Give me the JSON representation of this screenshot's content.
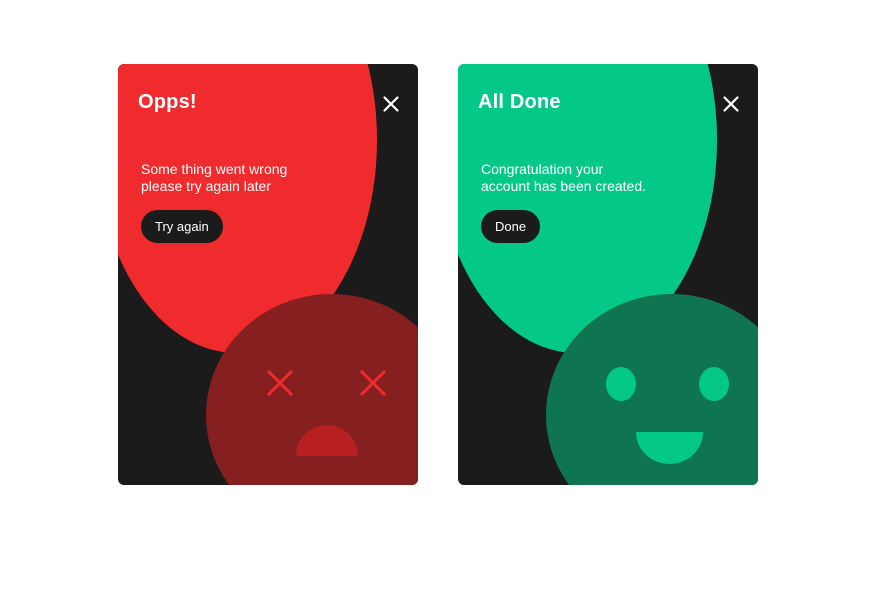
{
  "error_card": {
    "title": "Opps!",
    "message_lines": [
      "Some thing went wrong",
      "please try again later"
    ],
    "button_label": "Try again",
    "close_icon": "close-icon",
    "colors": {
      "background": "#1b1b1b",
      "circle": "#ef2b2d",
      "face": "#851f20",
      "eyes": "#ef2b2d",
      "mouth": "#b81f20"
    },
    "face_icon": "sad-face"
  },
  "success_card": {
    "title": "All Done",
    "message_lines": [
      "Congratulation your",
      "account has been created."
    ],
    "button_label": "Done",
    "close_icon": "close-icon",
    "colors": {
      "background": "#1b1b1b",
      "circle": "#04c887",
      "face": "#0f7550",
      "eyes": "#04c887",
      "mouth": "#04c887"
    },
    "face_icon": "happy-face"
  }
}
